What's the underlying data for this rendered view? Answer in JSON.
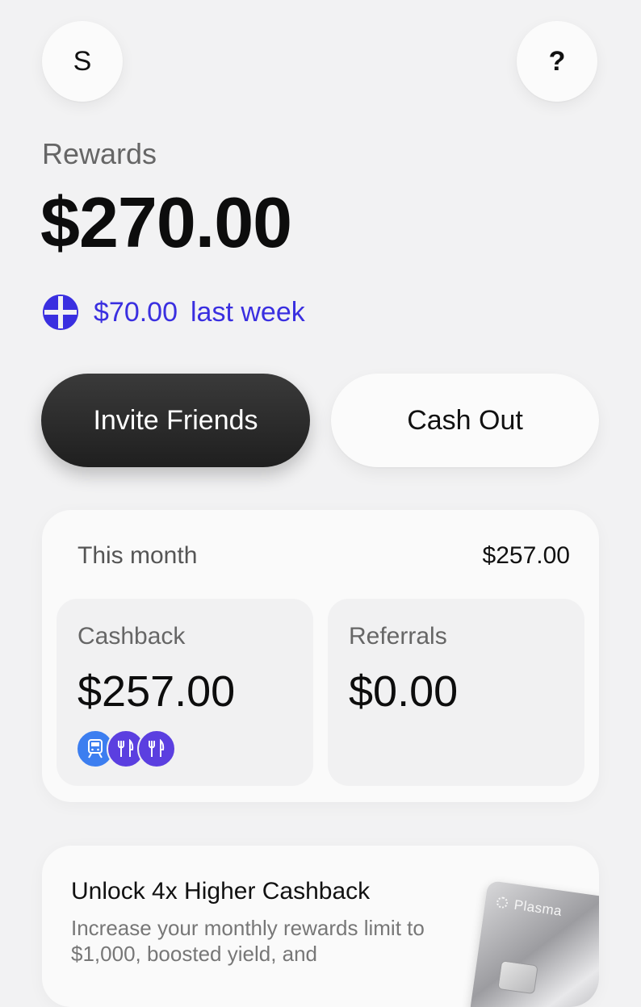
{
  "header": {
    "avatar_initial": "S",
    "help_label": "?"
  },
  "rewards": {
    "label": "Rewards",
    "amount": "$270.00",
    "weekly_amount": "$70.00",
    "weekly_label": "last week"
  },
  "actions": {
    "invite_label": "Invite Friends",
    "cashout_label": "Cash Out"
  },
  "this_month": {
    "label": "This month",
    "total": "$257.00",
    "cashback": {
      "label": "Cashback",
      "amount": "$257.00",
      "category_icons": [
        "train-icon",
        "fork-knife-icon",
        "fork-knife-icon"
      ]
    },
    "referrals": {
      "label": "Referrals",
      "amount": "$0.00"
    }
  },
  "promo": {
    "title": "Unlock 4x Higher Cashback",
    "description": "Increase your monthly rewards limit to $1,000, boosted yield, and",
    "card_brand": "Plasma"
  },
  "colors": {
    "accent": "#3a2fe0",
    "background": "#f2f2f3",
    "dark_button": "#262626"
  }
}
